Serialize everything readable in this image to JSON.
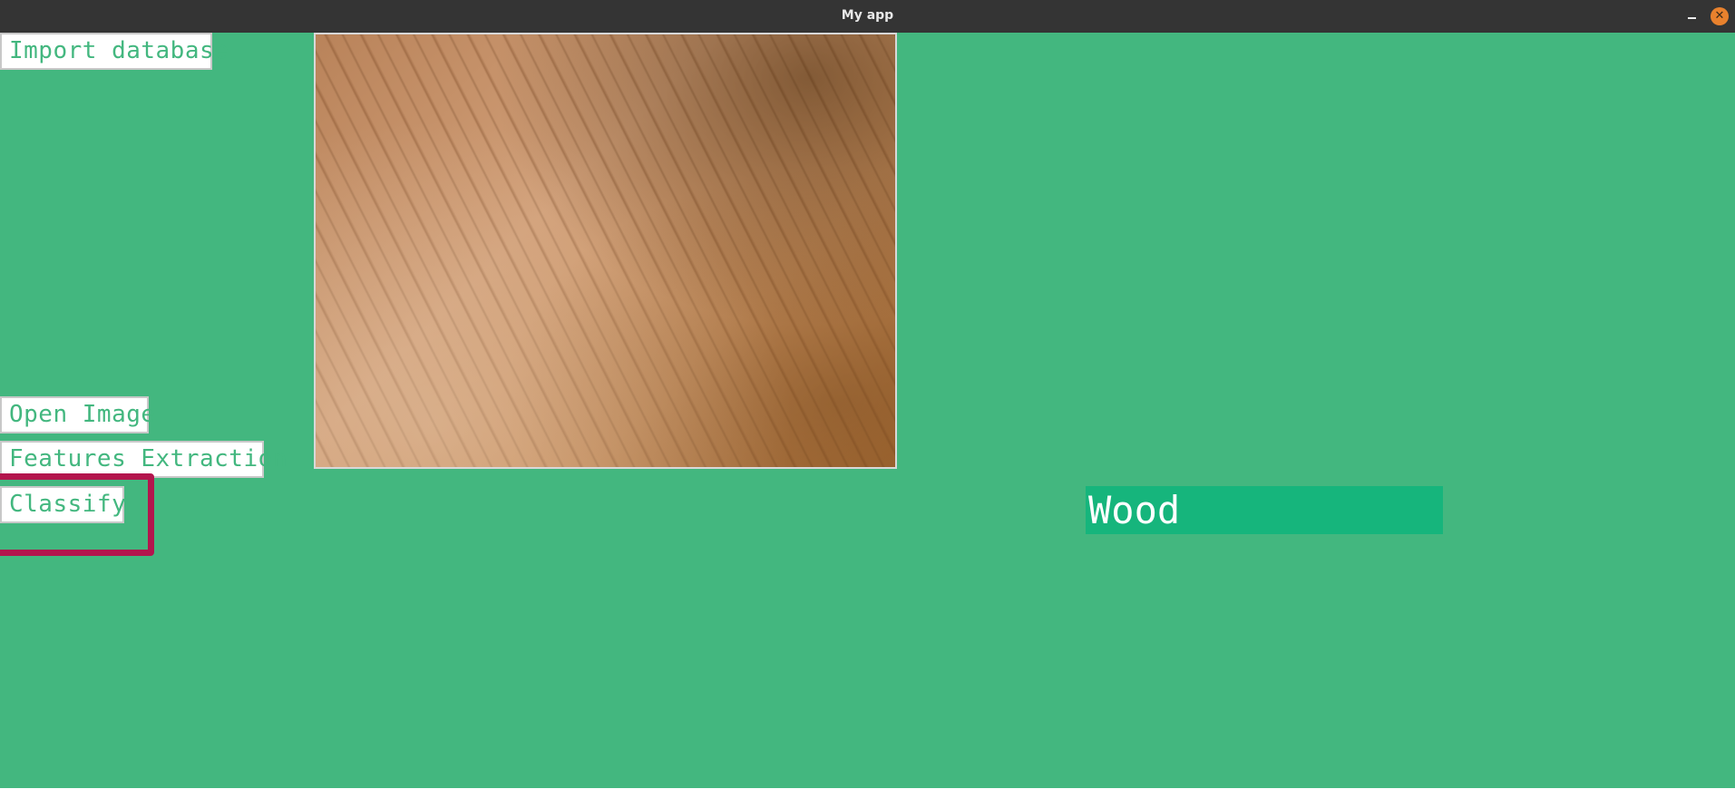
{
  "window": {
    "title": "My app",
    "minimize_icon": "minimize-icon",
    "close_icon": "close-icon",
    "close_glyph": "✕"
  },
  "buttons": {
    "import_label": "Import database",
    "open_label": "Open Image",
    "features_label": "Features Extraction",
    "classify_label": "Classify"
  },
  "preview": {
    "content": "wood texture photo"
  },
  "result": {
    "label": "Wood"
  },
  "colors": {
    "background": "#43b77f",
    "titlebar": "#343434",
    "button_text": "#43b77f",
    "result_background": "#16b57c",
    "highlight": "#b3154d",
    "close_button": "#e8812d"
  }
}
